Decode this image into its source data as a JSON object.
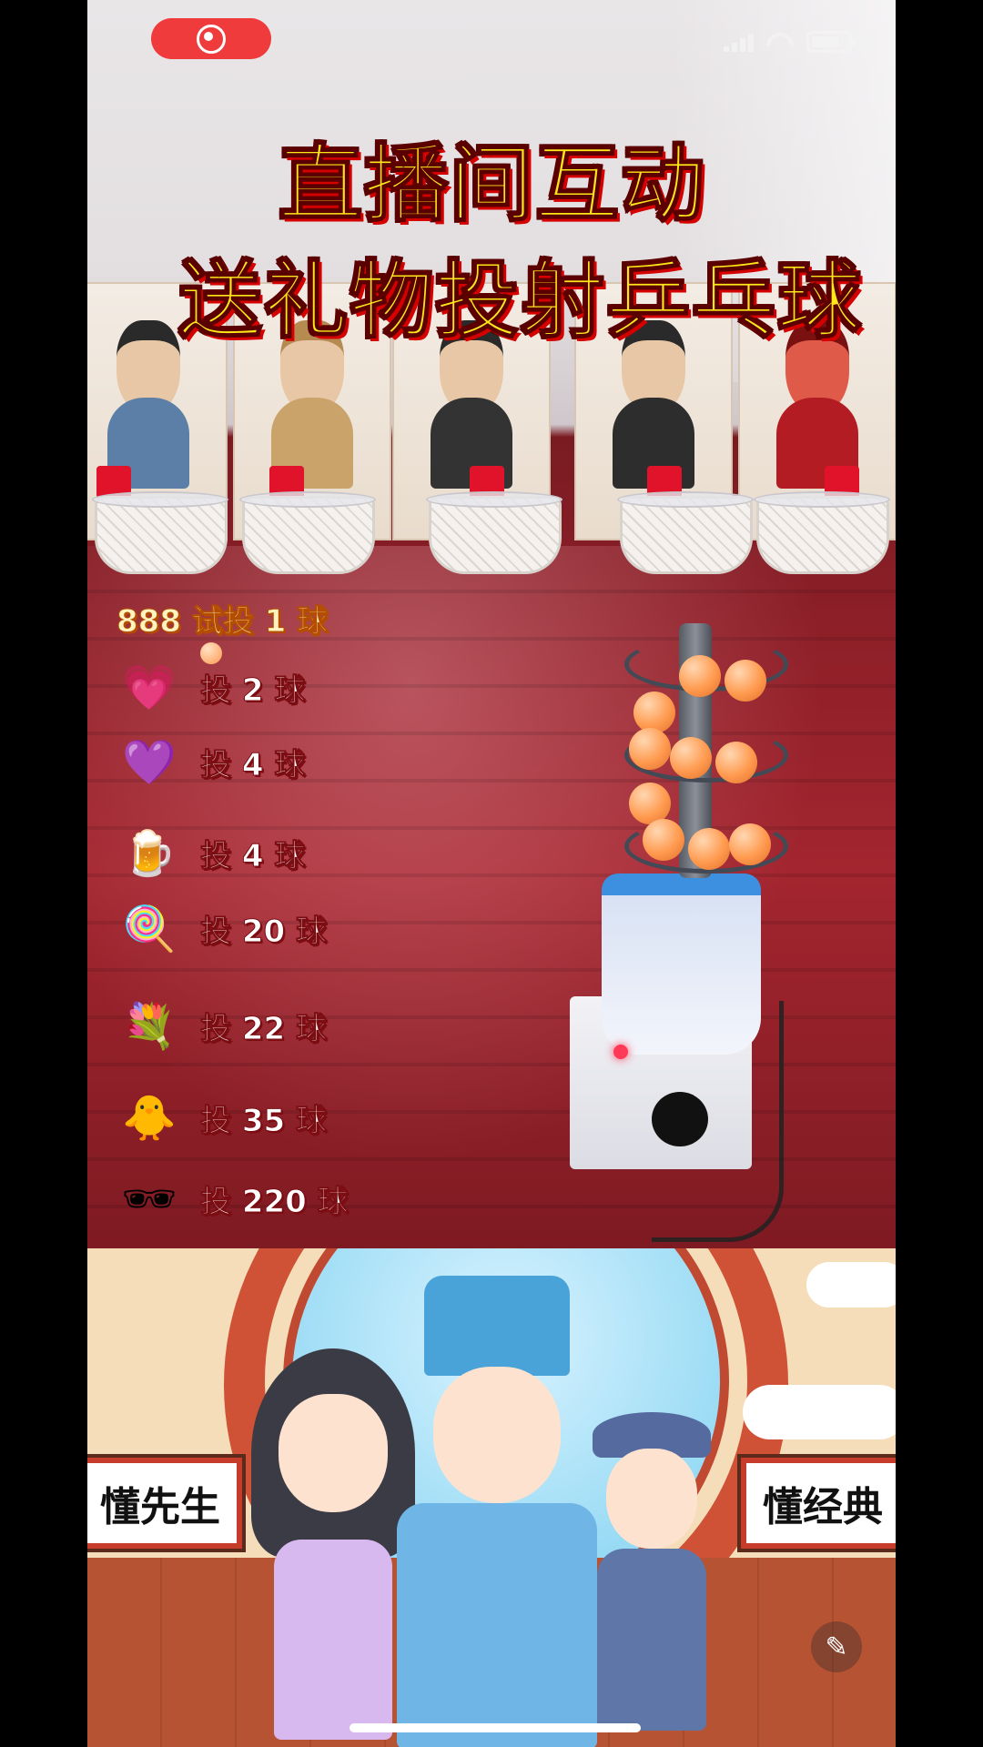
{
  "overlay": {
    "title_line1": "直播间互动",
    "title_line2": "送礼物投射乒乓球"
  },
  "gift_list": {
    "header": "888 试投 1 球",
    "items": [
      {
        "icon": "heart-planet-icon",
        "emoji": "💗",
        "label": "投 2 球"
      },
      {
        "icon": "heart-badge-icon",
        "emoji": "💜",
        "label": "投 4 球"
      },
      {
        "icon": "beer-mug-icon",
        "emoji": "🍺",
        "label": "投 4 球"
      },
      {
        "icon": "lollipop-icon",
        "emoji": "🍭",
        "label": "投 20 球"
      },
      {
        "icon": "rose-bouquet-icon",
        "emoji": "💐",
        "label": "投 22 球"
      },
      {
        "icon": "duck-icon",
        "emoji": "🐥",
        "label": "投 35 球"
      },
      {
        "icon": "sunglasses-icon",
        "emoji": "🕶",
        "label": "投 220 球"
      }
    ]
  },
  "banner": {
    "left_sign": "懂先生",
    "right_sign": "懂经典"
  },
  "colors": {
    "title_fill": "#ffe81a",
    "title_outline": "#d50000",
    "record_pill": "#ef3b3b"
  }
}
